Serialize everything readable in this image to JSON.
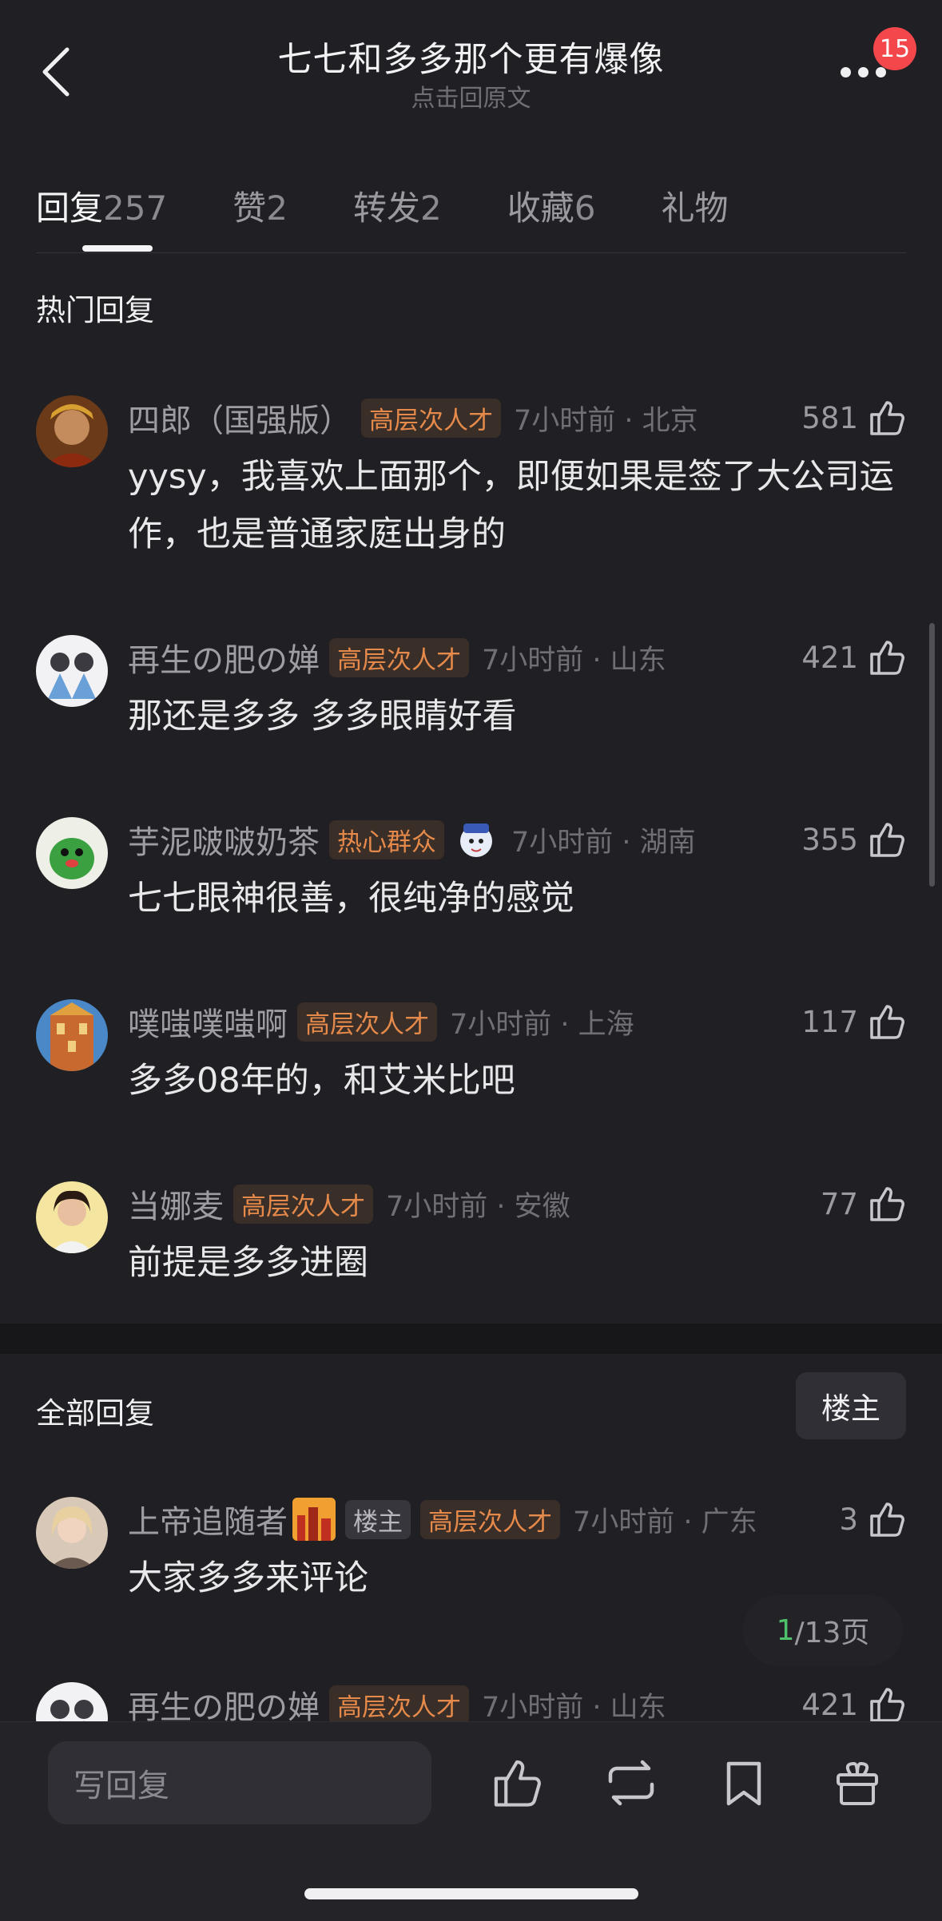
{
  "header": {
    "title": "七七和多多那个更有爆像",
    "subtitle": "点击回原文",
    "notification_count": "15"
  },
  "tabs": [
    {
      "label": "回复",
      "count": "257"
    },
    {
      "label": "赞",
      "count": "2"
    },
    {
      "label": "转发",
      "count": "2"
    },
    {
      "label": "收藏",
      "count": "6"
    },
    {
      "label": "礼物",
      "count": ""
    }
  ],
  "hot_section": {
    "title": "热门回复",
    "comments": [
      {
        "user": "四郎（国强版）",
        "tag": "高层次人才",
        "time": "7小时前 · 北京",
        "likes": "581",
        "text": "yysy，我喜欢上面那个，即便如果是签了大公司运作，也是普通家庭出身的"
      },
      {
        "user": "再生の肥の婵",
        "tag": "高层次人才",
        "time": "7小时前 · 山东",
        "likes": "421",
        "text": "那还是多多 多多眼睛好看"
      },
      {
        "user": "芋泥啵啵奶茶",
        "tag": "热心群众",
        "time": "7小时前 · 湖南",
        "likes": "355",
        "text": "七七眼神很善，很纯净的感觉"
      },
      {
        "user": "噗嗤噗嗤啊",
        "tag": "高层次人才",
        "time": "7小时前 · 上海",
        "likes": "117",
        "text": "多多08年的，和艾米比吧"
      },
      {
        "user": "当娜麦",
        "tag": "高层次人才",
        "time": "7小时前 · 安徽",
        "likes": "77",
        "text": "前提是多多进圈"
      }
    ]
  },
  "all_section": {
    "title": "全部回复",
    "owner_filter": "楼主",
    "comments": [
      {
        "user": "上帝追随者",
        "host_tag": "楼主",
        "tag": "高层次人才",
        "time": "7小时前 · 广东",
        "likes": "3",
        "text": "大家多多来评论"
      },
      {
        "user": "再生の肥の婵",
        "tag": "高层次人才",
        "time": "7小时前 · 山东",
        "likes": "421",
        "text": ""
      }
    ]
  },
  "pagination": {
    "current": "1",
    "total": "/13页"
  },
  "bottom_bar": {
    "reply_placeholder": "写回复"
  },
  "colors": {
    "background": "#202024",
    "tag_orange": "#e58a4a",
    "page_current": "#4ec26a",
    "badge": "#f3474b"
  }
}
